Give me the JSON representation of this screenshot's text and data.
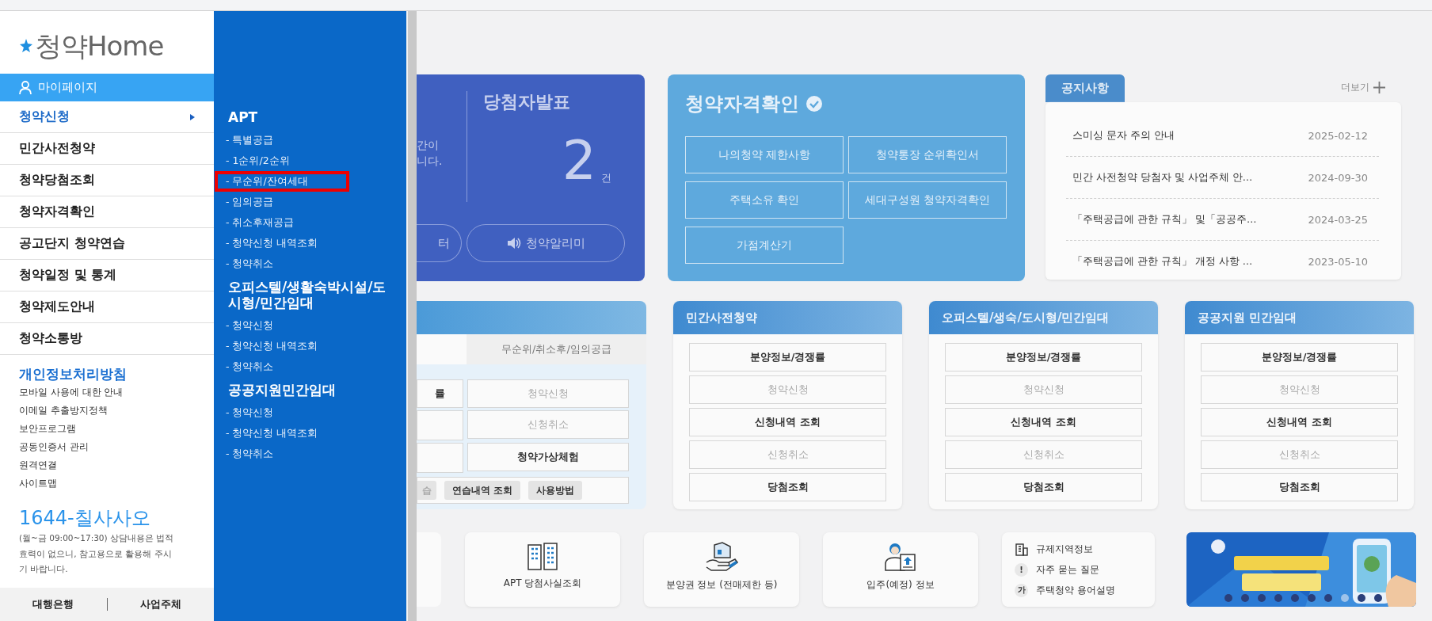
{
  "sidebar": {
    "logo": "청약Home",
    "mypage": "마이페이지",
    "menu": [
      {
        "label": "청약신청",
        "selected": true
      },
      {
        "label": "민간사전청약",
        "selected": false
      },
      {
        "label": "청약당첨조회",
        "selected": false
      },
      {
        "label": "청약자격확인",
        "selected": false
      },
      {
        "label": "공고단지 청약연습",
        "selected": false
      },
      {
        "label": "청약일정 및 통계",
        "selected": false
      },
      {
        "label": "청약제도안내",
        "selected": false
      },
      {
        "label": "청약소통방",
        "selected": false
      }
    ],
    "policy": "개인정보처리방침",
    "links": [
      "모바일 사용에 대한 안내",
      "이메일 추출방지정책",
      "보안프로그램",
      "공동인증서 관리",
      "원격연결",
      "사이트맵"
    ],
    "phone": "1644-칠사사오",
    "note": "(월~금 09:00~17:30) 상담내용은 법적효력이 없으니, 참고용으로 활용해 주시기 바랍니다.",
    "footer_links": [
      "대행은행",
      "사업주체"
    ]
  },
  "submenu": {
    "sections": [
      {
        "heading": "APT",
        "items": [
          {
            "label": "- 특별공급",
            "highlighted": false
          },
          {
            "label": "- 1순위/2순위",
            "highlighted": false
          },
          {
            "label": "- 무순위/잔여세대",
            "highlighted": true
          },
          {
            "label": "- 임의공급",
            "highlighted": false
          },
          {
            "label": "- 취소후재공급",
            "highlighted": false
          },
          {
            "label": "- 청약신청 내역조회",
            "highlighted": false
          },
          {
            "label": "- 청약취소",
            "highlighted": false
          }
        ]
      },
      {
        "heading": "오피스텔/생활숙박시설/도시형/민간임대",
        "items": [
          {
            "label": "- 청약신청",
            "highlighted": false
          },
          {
            "label": "- 청약신청 내역조회",
            "highlighted": false
          },
          {
            "label": "- 청약취소",
            "highlighted": false
          }
        ]
      },
      {
        "heading": "공공지원민간임대",
        "items": [
          {
            "label": "- 청약신청",
            "highlighted": false
          },
          {
            "label": "- 청약신청 내역조회",
            "highlighted": false
          },
          {
            "label": "- 청약취소",
            "highlighted": false
          }
        ]
      }
    ]
  },
  "winners_card": {
    "partial_lines": [
      "간이",
      "니다."
    ],
    "title": "당첨자발표",
    "count": "2",
    "unit": "건",
    "buttons": [
      {
        "label": "터"
      },
      {
        "label": "청약알리미"
      }
    ]
  },
  "eligibility_card": {
    "title": "청약자격확인",
    "buttons": [
      "나의청약 제한사항",
      "청약통장 순위확인서",
      "주택소유 확인",
      "세대구성원 청약자격확인",
      "가점계산기"
    ]
  },
  "notices": {
    "tab": "공지사항",
    "more": "더보기",
    "rows": [
      {
        "title": "스미싱 문자 주의 안내",
        "date": "2025-02-12"
      },
      {
        "title": "민간 사전청약 당첨자 및 사업주체 안…",
        "date": "2024-09-30"
      },
      {
        "title": "「주택공급에 관한 규칙」 및「공공주…",
        "date": "2024-03-25"
      },
      {
        "title": "「주택공급에 관한 규칙」 개정 사항 …",
        "date": "2023-05-10"
      }
    ]
  },
  "apply_card": {
    "tabs": [
      {
        "label": "무순위/취소후/임의공급",
        "selected": false
      }
    ],
    "grid": [
      {
        "kind": "button",
        "label": "률",
        "disabled": false
      },
      {
        "kind": "button",
        "label": "청약신청",
        "disabled": true
      },
      {
        "kind": "blank"
      },
      {
        "kind": "button",
        "label": "신청취소",
        "disabled": true
      },
      {
        "kind": "blank"
      },
      {
        "kind": "button",
        "label": "청약가상체험",
        "disabled": false
      }
    ],
    "pills": [
      {
        "label": "습",
        "disabled": true
      },
      {
        "label": "연습내역 조회",
        "disabled": false
      },
      {
        "label": "사용방법",
        "disabled": false
      }
    ]
  },
  "service_cards": [
    {
      "title": "민간사전청약",
      "buttons": [
        {
          "label": "분양정보/경쟁률",
          "disabled": false
        },
        {
          "label": "청약신청",
          "disabled": true
        },
        {
          "label": "신청내역 조회",
          "disabled": false
        },
        {
          "label": "신청취소",
          "disabled": true
        },
        {
          "label": "당첨조회",
          "disabled": false
        }
      ]
    },
    {
      "title": "오피스텔/생숙/도시형/민간임대",
      "buttons": [
        {
          "label": "분양정보/경쟁률",
          "disabled": false
        },
        {
          "label": "청약신청",
          "disabled": true
        },
        {
          "label": "신청내역 조회",
          "disabled": false
        },
        {
          "label": "신청취소",
          "disabled": true
        },
        {
          "label": "당첨조회",
          "disabled": false
        }
      ]
    },
    {
      "title": "공공지원 민간임대",
      "buttons": [
        {
          "label": "분양정보/경쟁률",
          "disabled": false
        },
        {
          "label": "청약신청",
          "disabled": true
        },
        {
          "label": "신청내역 조회",
          "disabled": false
        },
        {
          "label": "신청취소",
          "disabled": true
        },
        {
          "label": "당첨조회",
          "disabled": false
        }
      ]
    }
  ],
  "quick_tiles": [
    {
      "kind": "cut"
    },
    {
      "kind": "tile",
      "label": "APT 당첨사실조회"
    },
    {
      "kind": "tile",
      "label": "분양권 정보 (전매제한 등)"
    },
    {
      "kind": "tile",
      "label": "입주(예정) 정보"
    }
  ],
  "help_links": [
    {
      "label": "규제지역정보"
    },
    {
      "label": "자주 묻는 질문",
      "glyph": "!"
    },
    {
      "label": "주택청약 용어설명",
      "glyph": "가"
    }
  ],
  "banner": {
    "kind": "picture",
    "slides": [
      {
        "selected": false
      },
      {
        "selected": false
      },
      {
        "selected": false
      },
      {
        "selected": false
      },
      {
        "selected": false
      },
      {
        "selected": false
      },
      {
        "selected": false
      },
      {
        "selected": true
      },
      {
        "selected": false
      },
      {
        "selected": false
      }
    ]
  }
}
